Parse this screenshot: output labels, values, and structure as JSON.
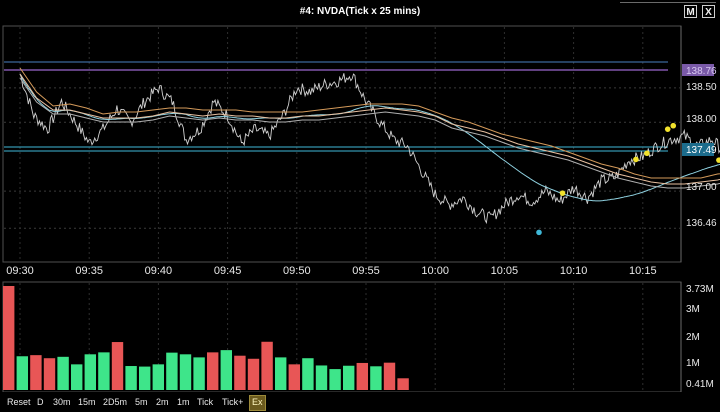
{
  "window": {
    "title": "#4: NVDA(Tick x 25 mins)",
    "maximize_label": "M",
    "close_label": "X"
  },
  "price_axis": {
    "ticks": [
      "138.50",
      "138.00",
      "137.00",
      "136.46"
    ],
    "current_price_label": "137.49",
    "top_line_label": "138.76"
  },
  "time_axis": {
    "labels": [
      "09:30",
      "09:35",
      "09:40",
      "09:45",
      "09:50",
      "09:55",
      "10:00",
      "10:05",
      "10:10",
      "10:15"
    ]
  },
  "volume_axis": {
    "labels": [
      "3.73M",
      "3M",
      "2M",
      "1M",
      "0.41M"
    ]
  },
  "timeframe_buttons": [
    {
      "label": "Reset"
    },
    {
      "label": "D"
    },
    {
      "label": "30m"
    },
    {
      "label": "15m"
    },
    {
      "label": "2D5m"
    },
    {
      "label": "5m"
    },
    {
      "label": "2m"
    },
    {
      "label": "1m"
    },
    {
      "label": "Tick"
    },
    {
      "label": "Tick+"
    },
    {
      "label": "Ex",
      "active": true
    }
  ],
  "colors": {
    "up": "#3ee58a",
    "down": "#e85656",
    "price_line": "#d0d0d0",
    "vwap": "#8fd1e0",
    "ma_orange": "#d49a5a",
    "ma_peach": "#e8c0a0",
    "current_line": "#3fb8d8",
    "top_line": "#9a66cc",
    "highlight": "#f2e22c"
  },
  "chart_data": {
    "type": "bar",
    "title": "",
    "xlabel": "",
    "ylabel": "",
    "ylim": [
      0,
      3730000
    ],
    "values": [
      3730000,
      1210000,
      1250000,
      1140000,
      1190000,
      920000,
      1280000,
      1350000,
      1720000,
      860000,
      840000,
      920000,
      1340000,
      1280000,
      1170000,
      1350000,
      1430000,
      1230000,
      1120000,
      1730000,
      1170000,
      920000,
      1140000,
      880000,
      750000,
      870000,
      970000,
      850000,
      980000,
      420000
    ],
    "directions": [
      "down",
      "up",
      "down",
      "down",
      "up",
      "up",
      "up",
      "up",
      "down",
      "up",
      "up",
      "up",
      "up",
      "up",
      "up",
      "down",
      "up",
      "down",
      "down",
      "down",
      "up",
      "down",
      "up",
      "up",
      "up",
      "up",
      "down",
      "up",
      "down",
      "down"
    ]
  }
}
